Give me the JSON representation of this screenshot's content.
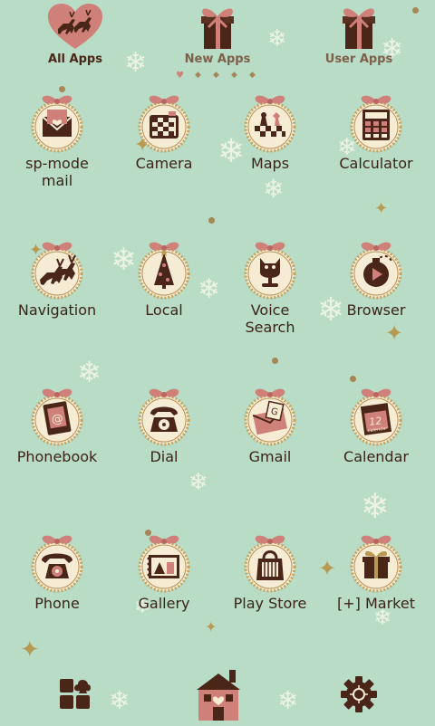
{
  "tabs": [
    {
      "label": "All Apps",
      "icon": "reindeer-heart-icon"
    },
    {
      "label": "New Apps",
      "icon": "gift-icon"
    },
    {
      "label": "User Apps",
      "icon": "gift-icon"
    }
  ],
  "apps": [
    {
      "label": "sp-mode\nmail",
      "icon": "envelope-icon"
    },
    {
      "label": "Camera",
      "icon": "camera-icon"
    },
    {
      "label": "Maps",
      "icon": "chess-map-icon"
    },
    {
      "label": "Calculator",
      "icon": "calculator-icon"
    },
    {
      "label": "Navigation",
      "icon": "reindeer-icon"
    },
    {
      "label": "Local",
      "icon": "christmas-tree-icon"
    },
    {
      "label": "Voice\nSearch",
      "icon": "microphone-icon"
    },
    {
      "label": "Browser",
      "icon": "browser-play-icon"
    },
    {
      "label": "Phonebook",
      "icon": "phonebook-icon"
    },
    {
      "label": "Dial",
      "icon": "rotary-phone-icon"
    },
    {
      "label": "Gmail",
      "icon": "gmail-envelope-icon"
    },
    {
      "label": "Calendar",
      "icon": "calendar-icon"
    },
    {
      "label": "Phone",
      "icon": "telephone-icon"
    },
    {
      "label": "Gallery",
      "icon": "gallery-stamp-icon"
    },
    {
      "label": "Play Store",
      "icon": "shopping-bag-icon"
    },
    {
      "label": "[+] Market",
      "icon": "gift-box-icon"
    }
  ],
  "calendar_icon_text": "12",
  "calendar_icon_sub": "calendar",
  "gmail_icon_letter": "G",
  "phonebook_icon_glyph": "@",
  "dock": [
    {
      "icon": "app-drawer-icon"
    },
    {
      "icon": "home-house-icon"
    },
    {
      "icon": "settings-gear-icon"
    }
  ],
  "colors": {
    "background": "#b8dcc6",
    "brown": "#4a2618",
    "pink": "#cf8179",
    "ring": "#c6a25c",
    "cream": "#f6ecd3"
  }
}
